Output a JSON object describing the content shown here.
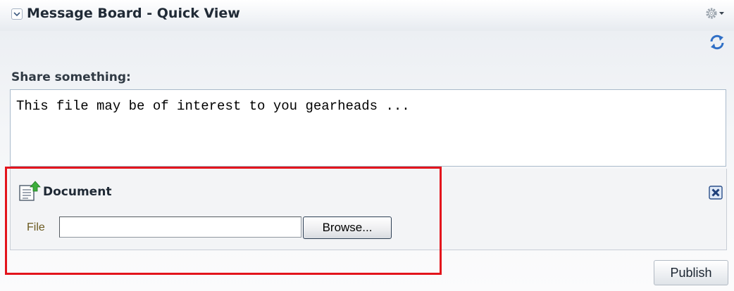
{
  "panel": {
    "title": "Message Board - Quick View",
    "icons": {
      "collapse": "chevron-down-icon",
      "settings": "gear-icon",
      "refresh": "refresh-icon"
    }
  },
  "share": {
    "label": "Share something:",
    "text": "This file may be of interest to you gearheads ..."
  },
  "attachment": {
    "type_label": "Document",
    "icon": "document-upload-icon",
    "file_label": "File",
    "file_value": "",
    "browse_label": "Browse...",
    "close_icon": "close-icon"
  },
  "actions": {
    "publish_label": "Publish"
  },
  "colors": {
    "highlight": "#e3141c",
    "file_label": "#6b5a20",
    "icon_blue": "#2f6fc6"
  }
}
